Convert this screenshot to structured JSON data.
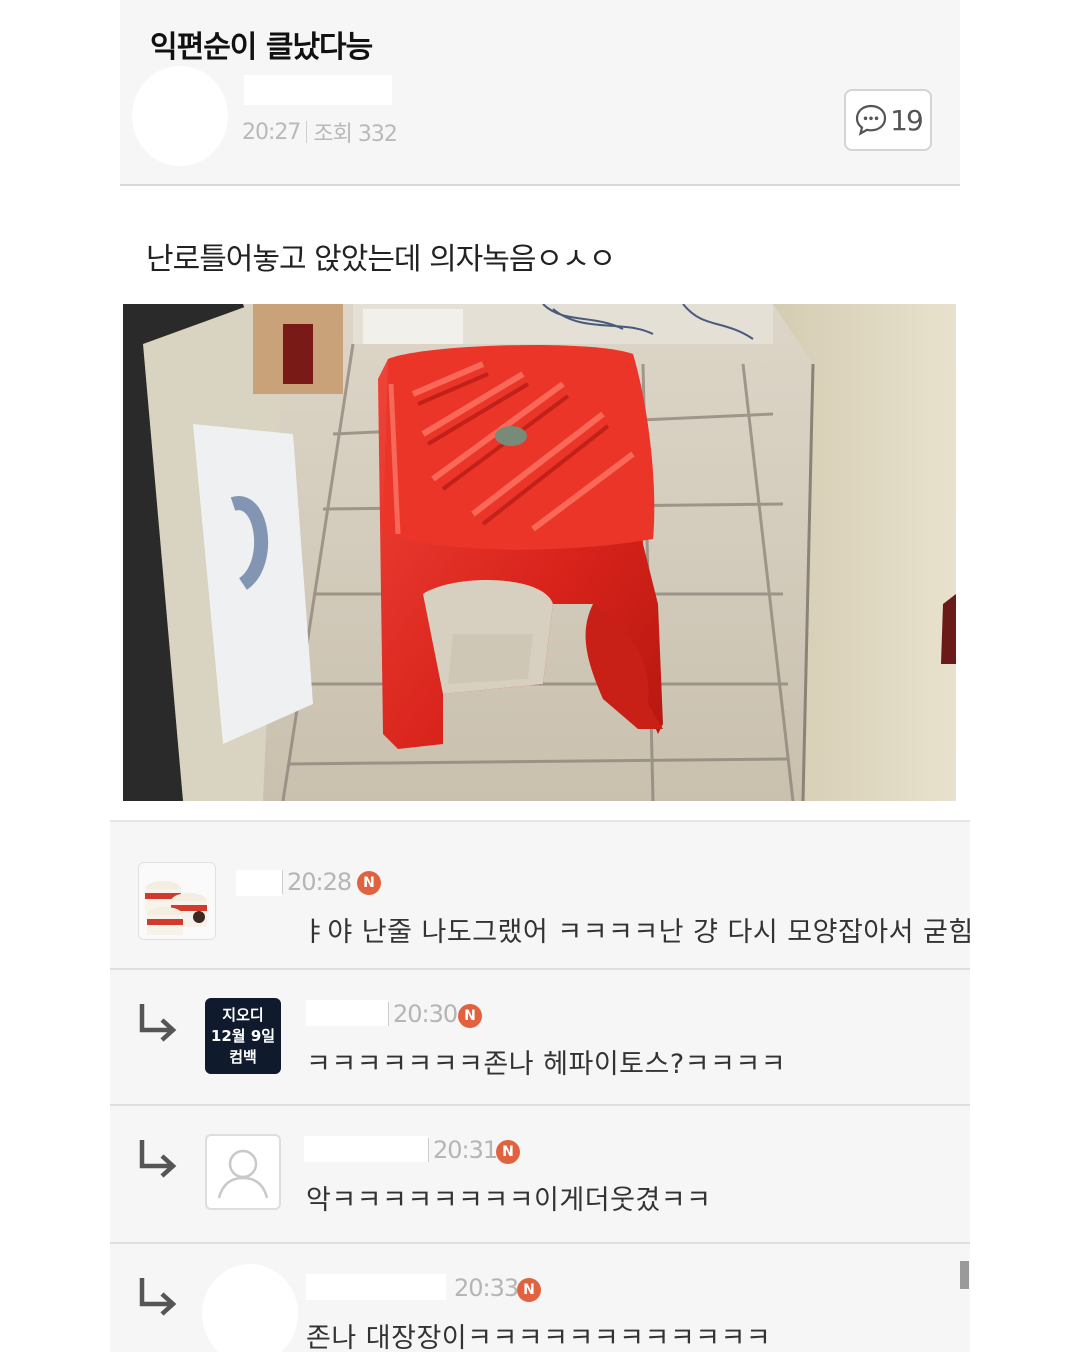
{
  "post": {
    "title": "익편순이 클났다능",
    "time": "20:27",
    "views": "조회 332",
    "comment_count": "19",
    "body": "난로틀어놓고 앉았는데 의자녹음ㅇㅅㅇ"
  },
  "comments": [
    {
      "time": "20:28",
      "badge": "N",
      "text": "ㅑ야 난줄 나도그랬어 ㅋㅋㅋㅋ난 걍 다시 모양잡아서 굳힘"
    },
    {
      "time": "20:30",
      "badge": "N",
      "avatar_text": [
        "지오디",
        "12월 9일",
        "컴백"
      ],
      "text": "ㅋㅋㅋㅋㅋㅋㅋ존나 헤파이토스?ㅋㅋㅋㅋ"
    },
    {
      "time": "20:31",
      "badge": "N",
      "text": "악ㅋㅋㅋㅋㅋㅋㅋㅋ이게더웃겼ㅋㅋ"
    },
    {
      "time": "20:33",
      "badge": "N",
      "text": "존나 대장장이ㅋㅋㅋㅋㅋㅋㅋㅋㅋㅋㅋㅋ"
    }
  ],
  "colors": {
    "new_badge": "#e1623e",
    "stool": "#e52b22",
    "muted_text": "#b9b9b9"
  },
  "icons": {
    "comment": "speech-bubble-icon",
    "reply": "reply-arrow-icon",
    "default_avatar": "person-silhouette-icon"
  }
}
